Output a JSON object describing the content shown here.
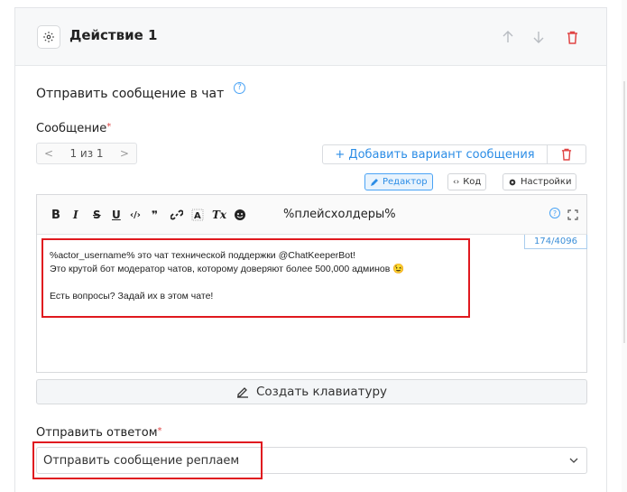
{
  "action": {
    "title": "Действие 1",
    "icons": {
      "settings": "gear-icon",
      "up": "arrow-up-icon",
      "down": "arrow-down-icon",
      "delete": "trash-icon"
    }
  },
  "section": {
    "title": "Отправить сообщение в чат",
    "help": "?"
  },
  "message": {
    "label": "Сообщение",
    "required_mark": "*",
    "pager": {
      "prev": "<",
      "current": "1 из 1",
      "next": ">"
    },
    "add_variant_label": "+ Добавить вариант сообщения",
    "modes": [
      {
        "label": "Редактор",
        "icon": "pencil-icon",
        "active": true
      },
      {
        "label": "Код",
        "icon": "code-icon",
        "active": false
      },
      {
        "label": "Настройки",
        "icon": "gear-icon",
        "active": false
      }
    ],
    "toolbar": {
      "bold": "B",
      "italic": "I",
      "strike": "S",
      "underline": "U",
      "code": "‹/›",
      "quote": "❞",
      "link": "link-icon",
      "spoiler": "spoiler-icon",
      "clear": "Tx",
      "emoji": "emoji-icon",
      "placeholders": "%плейсхолдеры%",
      "help": "?",
      "fullscreen": "expand-icon"
    },
    "counter": "174/4096",
    "lines": [
      "%actor_username% это чат технической поддержки @ChatKeeperBot!",
      "Это крутой бот модератор чатов, которому доверяют более 500,000 админов 😉",
      "",
      "Есть вопросы? Задай их в этом чате!"
    ]
  },
  "keyboard_button": "Создать клавиатуру",
  "reply": {
    "label": "Отправить ответом",
    "required_mark": "*",
    "selected": "Отправить сообщение реплаем"
  },
  "colors": {
    "accent": "#2c8de6",
    "danger": "#e04545",
    "highlight": "#e0191f"
  }
}
